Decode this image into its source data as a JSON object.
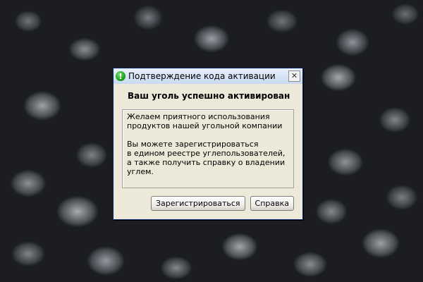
{
  "window": {
    "title": "Подтверждение кода активации",
    "icon": "check-icon",
    "close_label": "✕"
  },
  "content": {
    "heading": "Ваш уголь успешно активирован",
    "paragraph1": "Желаем приятного использования\nпродуктов нашей угольной компании",
    "paragraph2": "Вы можете зарегистрироваться\nв едином реестре углепользователей,\nа также получить справку о владении\nуглем."
  },
  "buttons": {
    "register_label": "Зарегистрироваться",
    "help_label": "Справка"
  },
  "colors": {
    "dialog_bg": "#ece9d8",
    "titlebar": "#c9d9f1",
    "icon_green": "#21a11d"
  }
}
